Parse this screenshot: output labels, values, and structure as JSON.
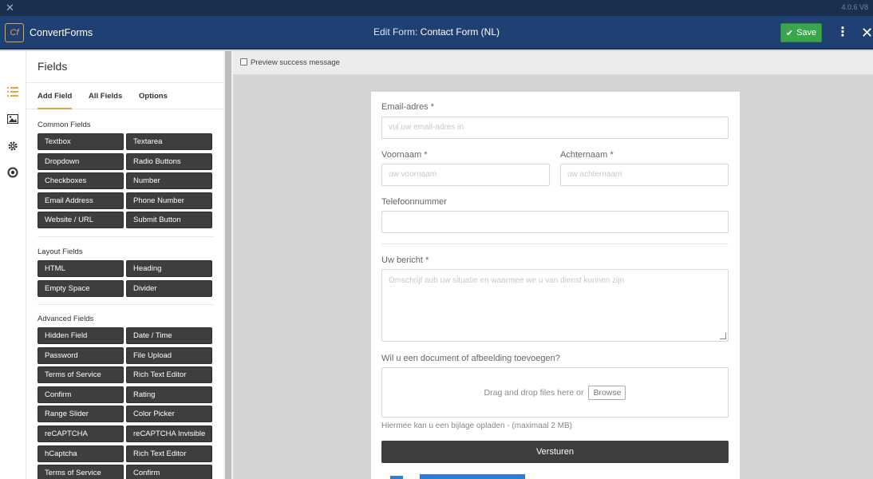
{
  "app": {
    "version": "4.0.6 V8",
    "brand_logo": "Cf",
    "brand_name": "ConvertForms",
    "title_prefix": "Edit Form:",
    "title_name": "Contact Form (NL)",
    "save_label": "Save",
    "colors": {
      "header": "#1f4072",
      "accent": "#e7a43a",
      "save": "#3aa54a",
      "button_dark": "#3e3e3e"
    }
  },
  "rail": {
    "icons": [
      "list-icon",
      "image-icon",
      "gear-icon",
      "circle-icon"
    ]
  },
  "panel": {
    "title": "Fields",
    "tabs": [
      {
        "label": "Add Field",
        "active": true
      },
      {
        "label": "All Fields",
        "active": false
      },
      {
        "label": "Options",
        "active": false
      }
    ],
    "sections": [
      {
        "title": "Common Fields",
        "buttons": [
          "Textbox",
          "Textarea",
          "Dropdown",
          "Radio Buttons",
          "Checkboxes",
          "Number",
          "Email Address",
          "Phone Number",
          "Website / URL",
          "Submit Button"
        ]
      },
      {
        "title": "Layout Fields",
        "buttons": [
          "HTML",
          "Heading",
          "Empty Space",
          "Divider"
        ]
      },
      {
        "title": "Advanced Fields",
        "buttons": [
          "Hidden Field",
          "Date / Time",
          "Password",
          "File Upload",
          "Terms of Service",
          "Rich Text Editor",
          "Confirm",
          "Rating",
          "Range Slider",
          "Color Picker",
          "reCAPTCHA",
          "reCAPTCHA Invisible",
          "hCaptcha",
          "Rich Text Editor",
          "Terms of Service",
          "Confirm"
        ]
      }
    ]
  },
  "canvas": {
    "preview_label": "Preview success message",
    "preview_checked": false
  },
  "form": {
    "email_label": "Email-adres *",
    "email_placeholder": "vul uw email-adres in",
    "firstname_label": "Voornaam *",
    "firstname_placeholder": "uw voornaam",
    "lastname_label": "Achternaam *",
    "lastname_placeholder": "uw achternaam",
    "phone_label": "Telefoonnummer",
    "phone_placeholder": "",
    "message_label": "Uw bericht *",
    "message_placeholder": "Omschrijf aub uw situatie en waarmee we u van dienst kunnen zijn",
    "upload_label": "Wil u een document of afbeelding toevoegen?",
    "upload_drop_text": "Drag and drop files here or",
    "upload_browse": "Browse",
    "upload_help": "Hiermee kan u een bijlage opladen - (maximaal 2 MB)",
    "submit_label": "Versturen"
  }
}
